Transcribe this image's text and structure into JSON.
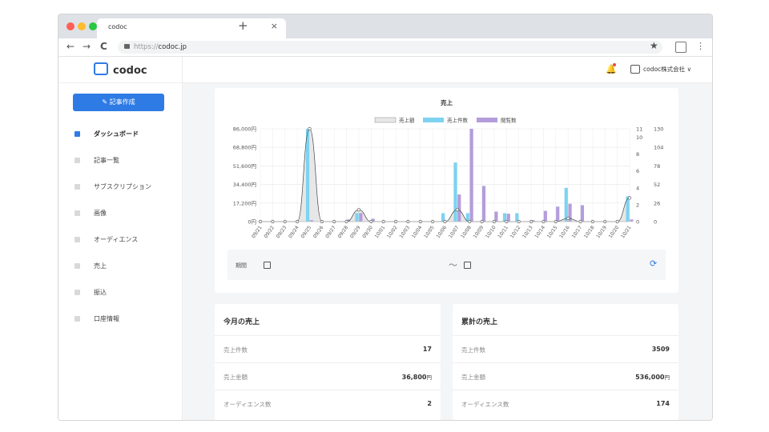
{
  "browser": {
    "tab_title": "codoc",
    "tab_close": "×",
    "new_tab": "+",
    "url_scheme": "https://",
    "url_host": "codoc.jp",
    "back": "←",
    "forward": "→",
    "reload": "C",
    "bookmark": "★",
    "menu": "⋮",
    "traffic_colors": [
      "#ff5f57",
      "#febc2e",
      "#28c840"
    ]
  },
  "sidebar": {
    "logo_text": "codoc",
    "new_article_button": "✎ 記事作成",
    "items": [
      {
        "label": "ダッシュボード",
        "icon": "dashboard-icon",
        "active": true
      },
      {
        "label": "記事一覧",
        "icon": "list-icon",
        "active": false
      },
      {
        "label": "サブスクリプション",
        "icon": "subscription-icon",
        "active": false
      },
      {
        "label": "画像",
        "icon": "image-icon",
        "active": false
      },
      {
        "label": "オーディエンス",
        "icon": "audience-icon",
        "active": false
      },
      {
        "label": "売上",
        "icon": "sales-icon",
        "active": false
      },
      {
        "label": "振込",
        "icon": "transfer-icon",
        "active": false
      },
      {
        "label": "口座情報",
        "icon": "account-icon",
        "active": false
      }
    ]
  },
  "topbar": {
    "company": "codoc株式会社 ∨",
    "bell": "🔔"
  },
  "chart_card": {
    "period_label": "期間",
    "tilde": "〜",
    "refresh": "⟳"
  },
  "chart_data": {
    "type": "bar",
    "title": "売上",
    "legend": [
      "売上額",
      "売上件数",
      "閲覧数"
    ],
    "legend_position": "top",
    "grid": true,
    "categories": [
      "09/21",
      "09/22",
      "09/23",
      "09/24",
      "09/25",
      "09/26",
      "09/27",
      "09/28",
      "09/29",
      "09/30",
      "10/01",
      "10/02",
      "10/03",
      "10/04",
      "10/05",
      "10/06",
      "10/07",
      "10/08",
      "10/09",
      "10/10",
      "10/11",
      "10/12",
      "10/13",
      "10/14",
      "10/15",
      "10/16",
      "10/17",
      "10/18",
      "10/19",
      "10/20",
      "10/21"
    ],
    "y_left": {
      "ticks": [
        "0円",
        "17,200円",
        "34,400円",
        "51,600円",
        "68,800円",
        "86,000円"
      ],
      "lim": [
        0,
        86000
      ]
    },
    "y_mid": {
      "ticks": [
        "0",
        "2",
        "4",
        "6",
        "8",
        "10",
        "11"
      ],
      "lim": [
        0,
        11
      ]
    },
    "y_right": {
      "ticks": [
        "0",
        "26",
        "52",
        "78",
        "104",
        "130"
      ],
      "lim": [
        0,
        130
      ]
    },
    "series": [
      {
        "name": "売上額",
        "kind": "area",
        "axis": "left",
        "color": "#b8b8b8",
        "values": [
          0,
          0,
          0,
          0,
          86000,
          0,
          0,
          0,
          11000,
          0,
          0,
          0,
          0,
          0,
          0,
          0,
          11000,
          0,
          0,
          0,
          0,
          0,
          0,
          0,
          0,
          3000,
          0,
          0,
          0,
          0,
          22000
        ]
      },
      {
        "name": "売上件数",
        "kind": "bar",
        "axis": "mid",
        "color": "#7dd3f0",
        "values": [
          0,
          0,
          0,
          0,
          11,
          0,
          0,
          0,
          1,
          0,
          0,
          0,
          0,
          0,
          0,
          1,
          7,
          1,
          0,
          0,
          1,
          1,
          0,
          0,
          0,
          4,
          0,
          0,
          0,
          0,
          3
        ]
      },
      {
        "name": "閲覧数",
        "kind": "bar",
        "axis": "right",
        "color": "#b39ddb",
        "values": [
          0,
          0,
          0,
          0,
          2,
          0,
          0,
          3,
          12,
          4,
          0,
          0,
          0,
          0,
          0,
          0,
          38,
          130,
          50,
          14,
          11,
          0,
          2,
          15,
          21,
          25,
          23,
          0,
          0,
          0,
          3
        ]
      }
    ]
  },
  "this_month": {
    "title": "今月の売上",
    "rows": [
      {
        "label": "売上件数",
        "value": "17",
        "unit": ""
      },
      {
        "label": "売上金額",
        "value": "36,800",
        "unit": "円"
      },
      {
        "label": "オーディエンス数",
        "value": "2",
        "unit": ""
      }
    ]
  },
  "cumulative": {
    "title": "累計の売上",
    "rows": [
      {
        "label": "売上件数",
        "value": "3509",
        "unit": ""
      },
      {
        "label": "売上金額",
        "value": "536,000",
        "unit": "円"
      },
      {
        "label": "オーディエンス数",
        "value": "174",
        "unit": ""
      }
    ]
  }
}
